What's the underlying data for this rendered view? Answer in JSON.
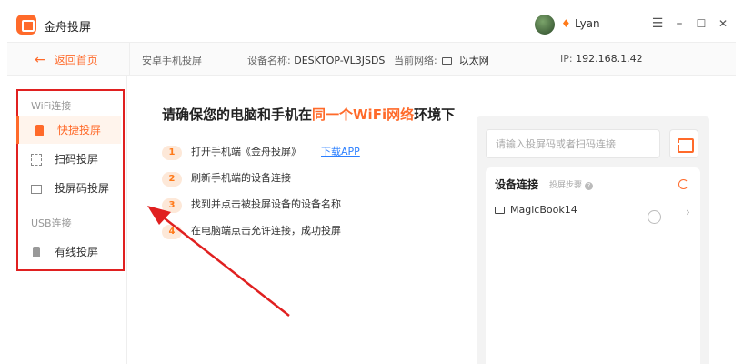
{
  "window": {
    "app_title": "金舟投屏",
    "username": "Lyan",
    "minimize": "–",
    "maximize": "☐",
    "close": "✕",
    "menu": "☰"
  },
  "subheader": {
    "back_label": "返回首页",
    "mode_label": "安卓手机投屏",
    "device_name_label": "设备名称:",
    "device_name": "DESKTOP-VL3JSDS",
    "network_label": "当前网络:",
    "network_value": "以太网",
    "ip_label": "IP:",
    "ip_value": "192.168.1.42"
  },
  "sidebar": {
    "wifi_group": "WiFi连接",
    "usb_group": "USB连接",
    "items": [
      {
        "label": "快捷投屏",
        "icon": "phone-icon"
      },
      {
        "label": "扫码投屏",
        "icon": "qr-icon"
      },
      {
        "label": "投屏码投屏",
        "icon": "code-icon"
      },
      {
        "label": "有线投屏",
        "icon": "usb-icon"
      }
    ]
  },
  "main": {
    "heading_pre": "请确保您的电脑和手机在",
    "heading_highlight": "同一个WiFi网络",
    "heading_post": "环境下",
    "steps": [
      {
        "num": "1",
        "text": "打开手机端《金舟投屏》",
        "link": "下载APP"
      },
      {
        "num": "2",
        "text": "刷新手机端的设备连接"
      },
      {
        "num": "3",
        "text": "找到并点击被投屏设备的设备名称"
      },
      {
        "num": "4",
        "text": "在电脑端点击允许连接，成功投屏"
      }
    ]
  },
  "right_panel": {
    "search_placeholder": "请输入投屏码或者扫码连接",
    "device_section_title": "设备连接",
    "device_section_sub": "投屏步骤",
    "devices": [
      {
        "name": "MagicBook14"
      }
    ]
  },
  "colors": {
    "accent": "#ff6a2a",
    "annotation": "#e02020",
    "link": "#2b7fff"
  }
}
